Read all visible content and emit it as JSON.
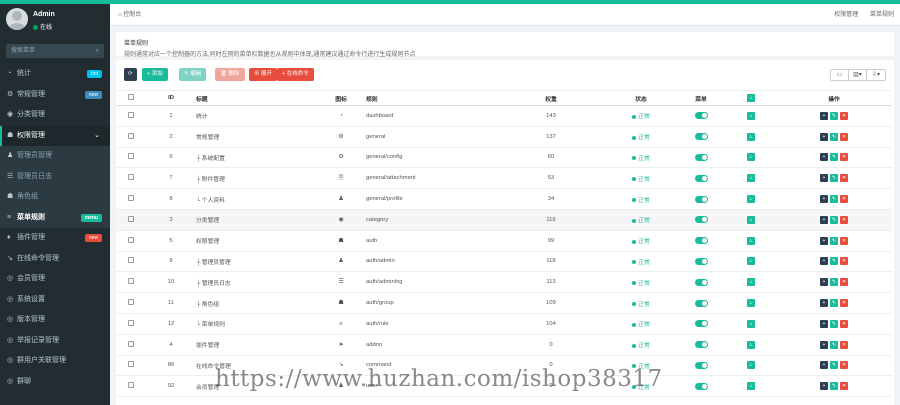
{
  "user": {
    "name": "Admin",
    "status": "在线"
  },
  "search": {
    "placeholder": "搜索菜单"
  },
  "menu": [
    {
      "icon": "◔",
      "label": "统计",
      "badge": "hot",
      "badge_color": "#00c0ef",
      "type": "item"
    },
    {
      "icon": "⚙",
      "label": "常规管理",
      "badge": "new",
      "badge_color": "#3c8dbc",
      "type": "item"
    },
    {
      "icon": "◉",
      "label": "分类管理",
      "type": "item"
    },
    {
      "icon": "☗",
      "label": "权限管理",
      "type": "active"
    },
    {
      "icon": "♟",
      "label": "管理员管理",
      "type": "sub"
    },
    {
      "icon": "☰",
      "label": "管理员日志",
      "type": "sub"
    },
    {
      "icon": "☗",
      "label": "角色组",
      "type": "sub"
    },
    {
      "icon": "≡",
      "label": "菜单规则",
      "badge": "menu",
      "badge_color": "#18bc9c",
      "type": "subcur"
    },
    {
      "icon": "♦",
      "label": "插件管理",
      "badge": "new",
      "badge_color": "#e74c3c",
      "type": "item"
    },
    {
      "icon": "↘",
      "label": "在线命令管理",
      "type": "item"
    },
    {
      "icon": "◎",
      "label": "会员管理",
      "type": "item"
    },
    {
      "icon": "◎",
      "label": "系统设置",
      "type": "item"
    },
    {
      "icon": "◎",
      "label": "版本管理",
      "type": "item"
    },
    {
      "icon": "◎",
      "label": "举报记录管理",
      "type": "item"
    },
    {
      "icon": "◎",
      "label": "群用户关联管理",
      "type": "item"
    },
    {
      "icon": "◎",
      "label": "群聊",
      "type": "item"
    }
  ],
  "breadcrumb": {
    "home": "控制台",
    "right": [
      "权限管理",
      "菜单规则"
    ]
  },
  "info": {
    "title": "菜单规则",
    "text": "规则通常对应一个控制器的方法,同时左侧的菜单栏数据也从规则中体现,通常建议通过命令行进行生成规则节点"
  },
  "toolbar": {
    "refresh": "⟳",
    "add": "+ 添加",
    "edit": "✎ 编辑",
    "delete": "🗑 删除",
    "expand": "⊕ 展开",
    "cli": "+ 在线命令"
  },
  "columns": {
    "id": "ID",
    "title": "标题",
    "icon": "图标",
    "rule": "规则",
    "weigh": "权重",
    "status": "状态",
    "ismenu": "菜单",
    "op": "操作"
  },
  "rows": [
    {
      "id": "1",
      "title": "统计",
      "icon": "◔",
      "rule": "dashboard",
      "weigh": "143",
      "status": "正常"
    },
    {
      "id": "2",
      "title": "常规管理",
      "icon": "⚙",
      "rule": "general",
      "weigh": "137",
      "status": "正常"
    },
    {
      "id": "6",
      "title": "├ 系统配置",
      "icon": "⚙",
      "rule": "general/config",
      "weigh": "60",
      "status": "正常"
    },
    {
      "id": "7",
      "title": "├ 附件管理",
      "icon": "🗎",
      "rule": "general/attachment",
      "weigh": "53",
      "status": "正常"
    },
    {
      "id": "8",
      "title": "└ 个人资料",
      "icon": "♟",
      "rule": "general/profile",
      "weigh": "34",
      "status": "正常"
    },
    {
      "id": "3",
      "title": "分类管理",
      "icon": "◉",
      "rule": "category",
      "weigh": "119",
      "status": "正常"
    },
    {
      "id": "5",
      "title": "权限管理",
      "icon": "☗",
      "rule": "auth",
      "weigh": "99",
      "status": "正常"
    },
    {
      "id": "9",
      "title": "├ 管理员管理",
      "icon": "♟",
      "rule": "auth/admin",
      "weigh": "118",
      "status": "正常"
    },
    {
      "id": "10",
      "title": "├ 管理员日志",
      "icon": "☰",
      "rule": "auth/adminlog",
      "weigh": "113",
      "status": "正常"
    },
    {
      "id": "11",
      "title": "├ 角色组",
      "icon": "☗",
      "rule": "auth/group",
      "weigh": "109",
      "status": "正常"
    },
    {
      "id": "12",
      "title": "└ 菜单规则",
      "icon": "≡",
      "rule": "auth/rule",
      "weigh": "104",
      "status": "正常"
    },
    {
      "id": "4",
      "title": "插件管理",
      "icon": "➤",
      "rule": "addon",
      "weigh": "0",
      "status": "正常"
    },
    {
      "id": "86",
      "title": "在线命令管理",
      "icon": "↘",
      "rule": "command",
      "weigh": "0",
      "status": "正常"
    },
    {
      "id": "92",
      "title": "会员管理",
      "icon": "♟",
      "rule": "user",
      "weigh": "0",
      "status": "正常"
    }
  ],
  "watermark": "https://www.huzhan.com/ishop38317"
}
